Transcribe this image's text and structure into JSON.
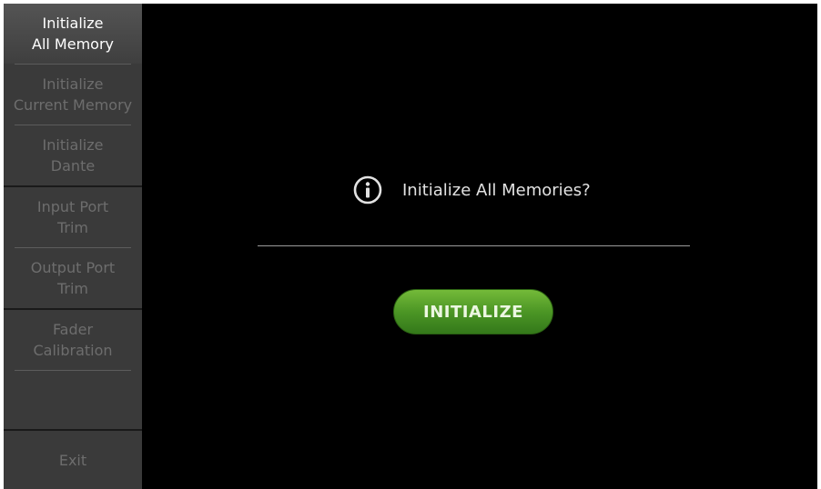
{
  "sidebar": {
    "items": [
      {
        "label": "Initialize\nAll Memory",
        "active": true
      },
      {
        "label": "Initialize\nCurrent Memory",
        "active": false
      },
      {
        "label": "Initialize\nDante",
        "active": false
      },
      {
        "label": "Input Port\nTrim",
        "active": false
      },
      {
        "label": "Output Port\nTrim",
        "active": false
      },
      {
        "label": "Fader\nCalibration",
        "active": false
      }
    ],
    "exit_label": "Exit"
  },
  "dialog": {
    "icon": "info-icon",
    "message": "Initialize All Memories?",
    "button_label": "INITIALIZE"
  },
  "colors": {
    "background": "#000000",
    "sidebar": "#3a3a3a",
    "button_green": "#4c9625"
  }
}
